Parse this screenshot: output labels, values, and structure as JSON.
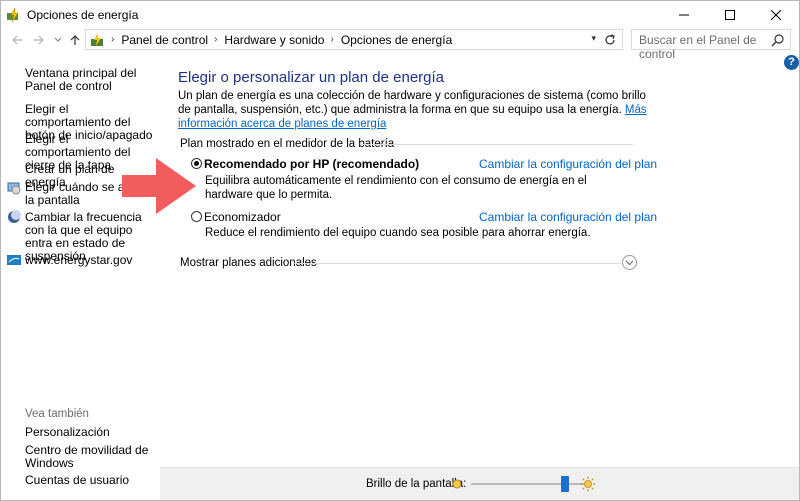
{
  "window": {
    "title": "Opciones de energía"
  },
  "address": {
    "crumbs": [
      "Panel de control",
      "Hardware y sonido",
      "Opciones de energía"
    ]
  },
  "search": {
    "placeholder": "Buscar en el Panel de control"
  },
  "help": {
    "label": "?"
  },
  "sidebar": {
    "links": [
      "Ventana principal del Panel de control",
      "Elegir el comportamiento del botón de inicio/apagado",
      "Elegir el comportamiento del cierre de la tapa",
      "Crear un plan de energía",
      "Elegir cuándo se apaga la pantalla",
      "Cambiar la frecuencia con la que el equipo entra en estado de suspensión",
      "www.energystar.gov"
    ],
    "see_also_heading": "Vea también",
    "see_also": [
      "Personalización",
      "Centro de movilidad de Windows",
      "Cuentas de usuario"
    ]
  },
  "main": {
    "title": "Elegir o personalizar un plan de energía",
    "description": "Un plan de energía es una colección de hardware y configuraciones de sistema (como brillo de pantalla, suspensión, etc.) que administra la forma en que su equipo usa la energía.",
    "description_link": "Más información acerca de planes de energía",
    "group_label": "Plan mostrado en el medidor de la batería",
    "plans": [
      {
        "name": "Recomendado por HP (recomendado)",
        "selected": true,
        "change_link": "Cambiar la configuración del plan",
        "description": "Equilibra automáticamente el rendimiento con el consumo de energía en el hardware que lo permita."
      },
      {
        "name": "Economizador",
        "selected": false,
        "change_link": "Cambiar la configuración del plan",
        "description": "Reduce el rendimiento del equipo cuando sea posible para ahorrar energía."
      }
    ],
    "more_plans": "Mostrar planes adicionales"
  },
  "bottom": {
    "brightness_label": "Brillo de la pantalla:",
    "brightness_level": 0.82
  },
  "colors": {
    "link": "#0066cc",
    "title": "#1e3287",
    "arrow": "#f25c5c",
    "slider": "#1a6fd1"
  }
}
